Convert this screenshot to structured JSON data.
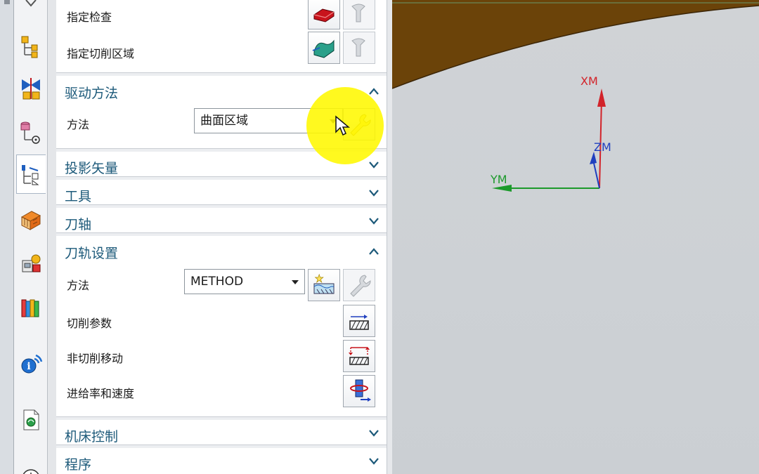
{
  "geometry_rows": [
    {
      "label": "指定检查"
    },
    {
      "label": "指定切削区域"
    }
  ],
  "drive_method": {
    "title": "驱动方法",
    "method_label": "方法",
    "method_value": "曲面区域"
  },
  "collapsed_groups": [
    {
      "title": "投影矢量"
    },
    {
      "title": "工具"
    },
    {
      "title": "刀轴"
    }
  ],
  "toolpath_settings": {
    "title": "刀轨设置",
    "method_label": "方法",
    "method_value": "METHOD",
    "cut_params_label": "切削参数",
    "non_cut_moves_label": "非切削移动",
    "feeds_speeds_label": "进给率和速度"
  },
  "bottom_groups": [
    {
      "title": "机床控制"
    },
    {
      "title": "程序"
    }
  ],
  "viewport": {
    "axes": {
      "x": "XM",
      "y": "YM",
      "z": "ZM"
    }
  },
  "colors": {
    "section_title": "#1d5a7a",
    "axis_x": "#d2232a",
    "axis_y": "#1c9a2b",
    "axis_z": "#1f3fbf",
    "part_surface": "#6b4309",
    "highlight": "#fff800"
  },
  "icons": {
    "resource_bar": [
      "assembly-navigator-icon",
      "constraint-navigator-icon",
      "part-navigator-icon",
      "operation-navigator-icon",
      "machine-tool-icon",
      "process-icon",
      "library-icon",
      "info-icon",
      "document-icon",
      "history-clock-icon"
    ]
  }
}
